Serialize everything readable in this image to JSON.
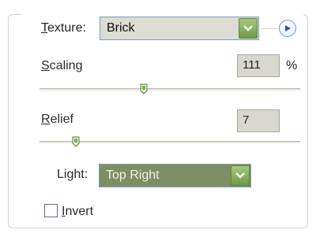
{
  "texture": {
    "label_mnemonic": "T",
    "label_rest": "exture:",
    "selected": "Brick"
  },
  "scaling": {
    "label_mnemonic": "S",
    "label_rest": "caling",
    "value": "111",
    "unit": "%",
    "slider_fraction": 0.4
  },
  "relief": {
    "label_mnemonic": "R",
    "label_rest": "elief",
    "value": "7",
    "slider_fraction": 0.14
  },
  "light": {
    "label_pre": "Li",
    "label_mnemonic": "g",
    "label_rest": "ht:",
    "selected": "Top Right"
  },
  "invert": {
    "label_mnemonic": "I",
    "label_rest": "nvert",
    "checked": false
  },
  "icons": {
    "dropdown": "chevron-down-icon",
    "panel_menu": "play-circle-icon",
    "slider_thumb": "slider-thumb-icon"
  },
  "colors": {
    "accent_green": "#7d8f62",
    "field_grey": "#dcdcd2",
    "frame_border": "#d9d4c6"
  }
}
